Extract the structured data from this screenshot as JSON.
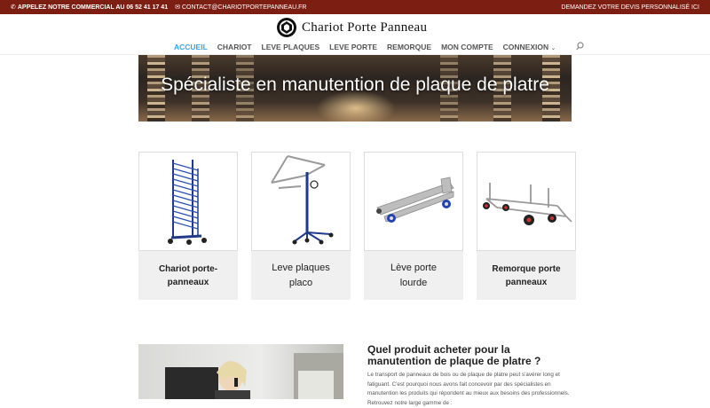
{
  "topbar": {
    "phone": "APPELEZ NOTRE COMMERCIAL AU 06 52 41 17 41",
    "email": "CONTACT@CHARIOTPORTEPANNEAU.FR",
    "quote": "DEMANDEZ VOTRE DEVIS PERSONNALISÉ ICI",
    "color": "#7c1e12"
  },
  "logo": {
    "text": "Chariot Porte Panneau"
  },
  "nav": {
    "items": [
      "ACCUEIL",
      "CHARIOT",
      "LEVE PLAQUES",
      "LEVE PORTE",
      "REMORQUE",
      "MON COMPTE",
      "CONNEXION"
    ],
    "active_color": "#2ea3f2",
    "dropdown_icon": "chevron-down-icon",
    "search_icon": "search-icon"
  },
  "hero": {
    "title": "Spécialiste en manutention de plaque de platre"
  },
  "products": [
    {
      "label": "Chariot porte-panneaux"
    },
    {
      "label": "Leve plaques placo"
    },
    {
      "label": "Lève porte lourde"
    },
    {
      "label": "Remorque porte panneaux"
    }
  ],
  "section": {
    "title": "Quel produit acheter pour la manutention de plaque de platre ?",
    "body": "Le transport de panneaux de bois ou de plaque de platre peut s'avérer long et fatiguant. C'est pourquoi nous avons fait concevoir par des spécialistes en manutention les produits qui répondent au mieux aux besoins des professionnels. Retrouvez notre large gamme de :"
  }
}
